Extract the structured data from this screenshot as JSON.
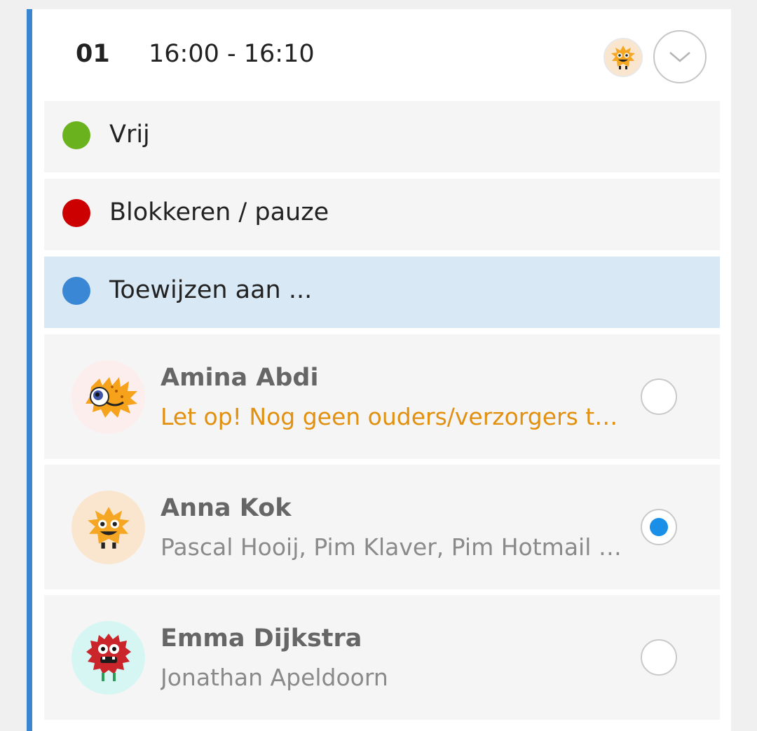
{
  "slot": {
    "number": "01",
    "time": "16:00 - 16:10"
  },
  "header": {
    "avatar_icon": "orange-monster-icon",
    "toggle_icon": "chevron-down-icon"
  },
  "colors": {
    "accent": "#3b86d0",
    "free": "#6ab31f",
    "blocked": "#cc0000",
    "assign": "#3a87d5",
    "warning": "#e1900f",
    "radio_selected": "#1a8fe8"
  },
  "options": [
    {
      "label": "Vrij",
      "color": "#6ab31f",
      "selected": false
    },
    {
      "label": "Blokkeren / pauze",
      "color": "#cc0000",
      "selected": false
    },
    {
      "label": "Toewijzen aan ...",
      "color": "#3a87d5",
      "selected": true
    }
  ],
  "students": [
    {
      "name": "Amina Abdi",
      "subtitle": "Let op! Nog geen ouders/verzorgers toegevoegd",
      "warning": true,
      "selected": false,
      "avatar_icon": "orange-spiky-fish-monster-icon",
      "avatar_bg": "#fdeeee"
    },
    {
      "name": "Anna Kok",
      "subtitle": "Pascal Hooij, Pim Klaver, Pim Hotmail en anderen",
      "warning": false,
      "selected": true,
      "avatar_icon": "orange-monster-icon",
      "avatar_bg": "#fae6cf"
    },
    {
      "name": "Emma Dijkstra",
      "subtitle": "Jonathan Apeldoorn",
      "warning": false,
      "selected": false,
      "avatar_icon": "red-furry-monster-icon",
      "avatar_bg": "#d6f6f3"
    }
  ]
}
